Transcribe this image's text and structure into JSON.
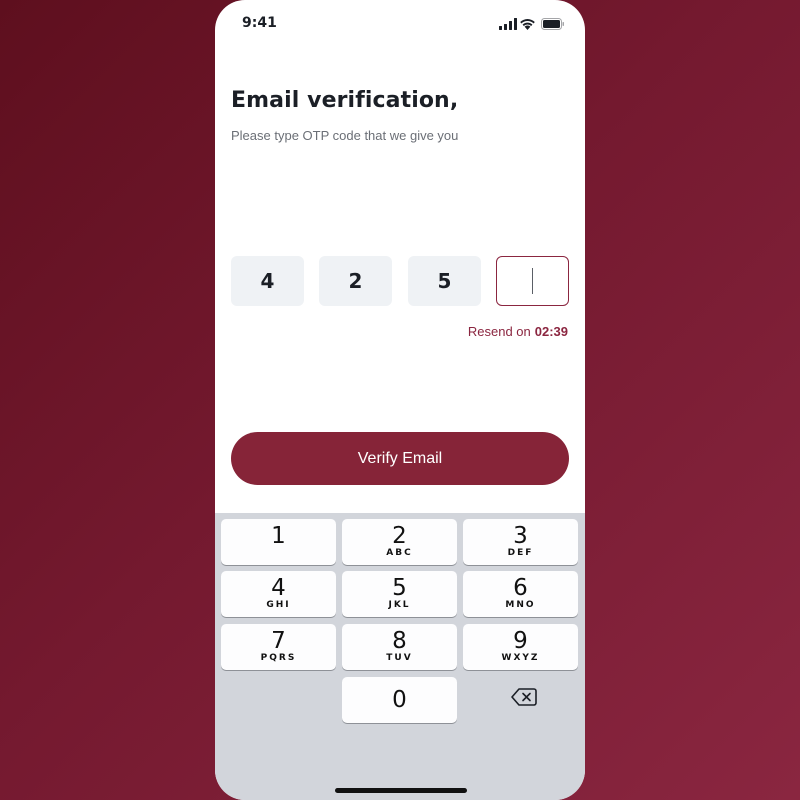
{
  "status_bar": {
    "time": "9:41",
    "icons": [
      "signal-icon",
      "wifi-icon",
      "battery-icon"
    ]
  },
  "header": {
    "title": "Email verification,",
    "subtitle": "Please type OTP code that we give you"
  },
  "otp": {
    "digits": [
      "4",
      "2",
      "5",
      ""
    ],
    "active_index": 3
  },
  "resend": {
    "label": "Resend on",
    "timer": "02:39"
  },
  "verify_button": {
    "label": "Verify Email"
  },
  "keypad": {
    "keys": [
      {
        "digit": "1",
        "letters": ""
      },
      {
        "digit": "2",
        "letters": "ABC"
      },
      {
        "digit": "3",
        "letters": "DEF"
      },
      {
        "digit": "4",
        "letters": "GHI"
      },
      {
        "digit": "5",
        "letters": "JKL"
      },
      {
        "digit": "6",
        "letters": "MNO"
      },
      {
        "digit": "7",
        "letters": "PQRS"
      },
      {
        "digit": "8",
        "letters": "TUV"
      },
      {
        "digit": "9",
        "letters": "WXYZ"
      },
      {
        "digit": "0",
        "letters": ""
      }
    ],
    "delete_icon": "backspace-icon"
  },
  "colors": {
    "accent": "#862438",
    "otp_box": "#eff2f5",
    "keypad_bg": "#d2d5db"
  }
}
